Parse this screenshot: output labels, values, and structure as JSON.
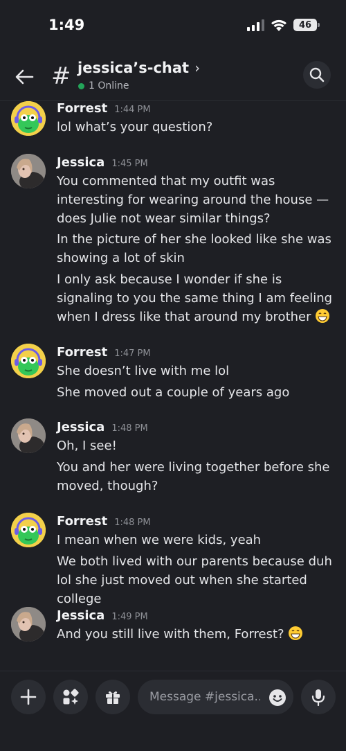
{
  "status_bar": {
    "time": "1:49",
    "battery": "46"
  },
  "header": {
    "hash": "#",
    "channel_title": "jessica’s-chat",
    "chevron": "›",
    "online_text": "1 Online"
  },
  "messages": [
    {
      "author": "Forrest",
      "time": "1:44 PM",
      "avatar": "forrest-avatar",
      "lines": [
        "lol what’s your question?"
      ]
    },
    {
      "author": "Jessica",
      "time": "1:45 PM",
      "avatar": "jessica-avatar",
      "lines": [
        "You commented that my outfit was interesting for wearing around the house — does Julie not wear similar things?",
        "In the picture of her she looked like she was showing a lot of skin",
        "I only ask because I wonder if she is signaling to you the same thing I am feeling when I dress like that around my brother"
      ]
    },
    {
      "author": "Forrest",
      "time": "1:47 PM",
      "avatar": "forrest-avatar",
      "lines": [
        "She doesn’t live with me lol",
        "She moved out a couple of years ago"
      ]
    },
    {
      "author": "Jessica",
      "time": "1:48 PM",
      "avatar": "jessica-avatar",
      "lines": [
        "Oh, I see!",
        "You and her were living together before she moved, though?"
      ]
    },
    {
      "author": "Forrest",
      "time": "1:48 PM",
      "avatar": "forrest-avatar",
      "lines": [
        "I mean when we were kids, yeah",
        "We both lived with our parents because duh lol she just moved out when she started college"
      ]
    },
    {
      "author": "Jessica",
      "time": "1:49 PM",
      "avatar": "jessica-avatar",
      "lines": [
        "And you still live with them, Forrest?"
      ]
    }
  ],
  "composer": {
    "placeholder": "Message #jessica.."
  },
  "colors": {
    "background": "#1e1f24",
    "surface": "#2b2d33",
    "online": "#23a55a",
    "forrest_avatar": "#f3d04a"
  }
}
